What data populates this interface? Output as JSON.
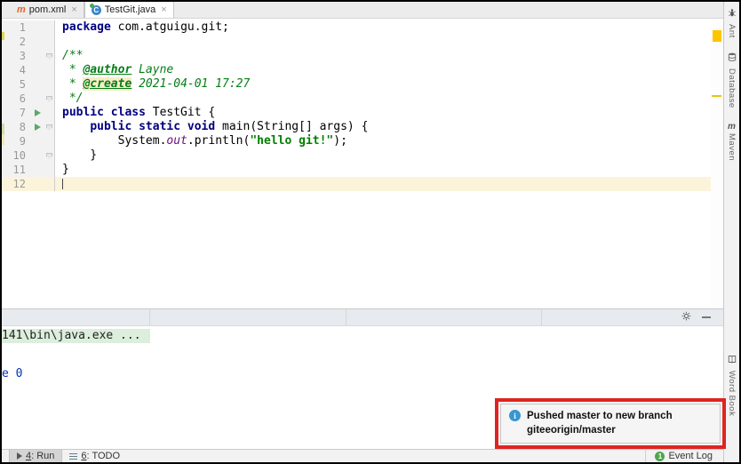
{
  "tab_bar": {
    "close_glyph": "×",
    "tabs": [
      {
        "label": "pom.xml",
        "icon": "maven-file-icon",
        "active": false
      },
      {
        "label": "TestGit.java",
        "icon": "java-class-icon",
        "active": true
      }
    ]
  },
  "editor": {
    "lines": [
      {
        "num": "1",
        "gutter": "",
        "fold": false,
        "caret": false,
        "tokens": [
          {
            "c": "kw",
            "t": "package"
          },
          {
            "c": "",
            "t": " com.atguigu.git;"
          }
        ]
      },
      {
        "num": "2",
        "gutter": "",
        "fold": false,
        "caret": false,
        "tokens": []
      },
      {
        "num": "3",
        "gutter": "",
        "fold": true,
        "caret": false,
        "tokens": [
          {
            "c": "cmt",
            "t": "/**"
          }
        ]
      },
      {
        "num": "4",
        "gutter": "",
        "fold": false,
        "caret": false,
        "tokens": [
          {
            "c": "cmt",
            "t": " * "
          },
          {
            "c": "tag",
            "t": "@author"
          },
          {
            "c": "cmt",
            "t": " Layne"
          }
        ]
      },
      {
        "num": "5",
        "gutter": "",
        "fold": false,
        "caret": false,
        "tokens": [
          {
            "c": "cmt",
            "t": " * "
          },
          {
            "c": "tag hl",
            "t": "@create"
          },
          {
            "c": "cmt",
            "t": " 2021-04-01 17:27"
          }
        ]
      },
      {
        "num": "6",
        "gutter": "",
        "fold": true,
        "caret": false,
        "tokens": [
          {
            "c": "cmt",
            "t": " */"
          }
        ]
      },
      {
        "num": "7",
        "gutter": "run",
        "fold": false,
        "caret": false,
        "tokens": [
          {
            "c": "kw",
            "t": "public class"
          },
          {
            "c": "",
            "t": " TestGit {"
          }
        ]
      },
      {
        "num": "8",
        "gutter": "run",
        "fold": true,
        "caret": false,
        "tokens": [
          {
            "c": "",
            "t": "    "
          },
          {
            "c": "kw",
            "t": "public static void"
          },
          {
            "c": "",
            "t": " main(String[] args) {"
          }
        ]
      },
      {
        "num": "9",
        "gutter": "",
        "fold": false,
        "caret": false,
        "tokens": [
          {
            "c": "",
            "t": "        System."
          },
          {
            "c": "fld",
            "t": "out"
          },
          {
            "c": "",
            "t": ".println("
          },
          {
            "c": "str",
            "t": "\"hello git!\""
          },
          {
            "c": "",
            "t": ");"
          }
        ]
      },
      {
        "num": "10",
        "gutter": "",
        "fold": true,
        "caret": false,
        "tokens": [
          {
            "c": "",
            "t": "    }"
          }
        ]
      },
      {
        "num": "11",
        "gutter": "",
        "fold": false,
        "caret": false,
        "tokens": [
          {
            "c": "",
            "t": "}"
          }
        ]
      },
      {
        "num": "12",
        "gutter": "",
        "fold": false,
        "caret": true,
        "tokens": []
      }
    ],
    "stripe_marks": {
      "warning_color": "#FFC400"
    }
  },
  "right_toolbar": {
    "top": [
      {
        "label": "Ant",
        "icon": "ant-icon"
      },
      {
        "label": "Database",
        "icon": "database-icon"
      },
      {
        "label": "Maven",
        "icon": "maven-icon"
      }
    ],
    "bottom": [
      {
        "label": "Word Book",
        "icon": "word-book-icon"
      }
    ]
  },
  "console": {
    "line1": "141\\bin\\java.exe ...",
    "exit_line": "e 0"
  },
  "notification": {
    "line1": "Pushed master to new branch",
    "line2": "giteeorigin/master",
    "annotation_color": "#DE2420"
  },
  "status_bar": {
    "run": {
      "key": "4",
      "rest": ": Run"
    },
    "todo": {
      "key": "6",
      "rest": ": TODO"
    },
    "event_log": {
      "badge": "1",
      "label": "Event Log"
    }
  }
}
